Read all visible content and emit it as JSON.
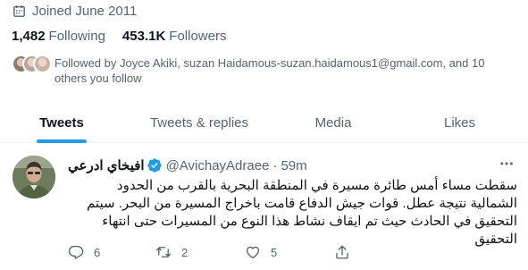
{
  "profile": {
    "joined": "Joined June 2011",
    "following_count": "1,482",
    "following_label": "Following",
    "followers_count": "453.1K",
    "followers_label": "Followers",
    "followed_by": "Followed by Joyce Akiki, suzan Haidamous-suzan.haidamous1@gmail.com, and 10 others you follow"
  },
  "tabs": [
    {
      "label": "Tweets"
    },
    {
      "label": "Tweets & replies"
    },
    {
      "label": "Media"
    },
    {
      "label": "Likes"
    }
  ],
  "tweet": {
    "display_name": "افيخاي ادرعي",
    "handle": "@AvichayAdraee",
    "separator": "·",
    "time": "59m",
    "text": "سقطت مساء أمس طائرة مسيرة في المنطقة البحرية بالقرب من الحدود الشمالية نتيجة عطل. قوات جيش الدفاع قامت باخراج المسيرة من البحر. سيتم التحقيق في الحادث حيث تم ايقاف نشاط هذا النوع من المسيرات حتى انتهاء التحقيق",
    "replies": "6",
    "retweets": "2",
    "likes": "5"
  },
  "colors": {
    "accent": "#1d9bf0",
    "secondary_text": "#536471",
    "primary_text": "#0f1419"
  },
  "icons": [
    "calendar-icon",
    "verified-badge-icon",
    "more-icon",
    "reply-icon",
    "retweet-icon",
    "like-icon",
    "share-icon"
  ]
}
